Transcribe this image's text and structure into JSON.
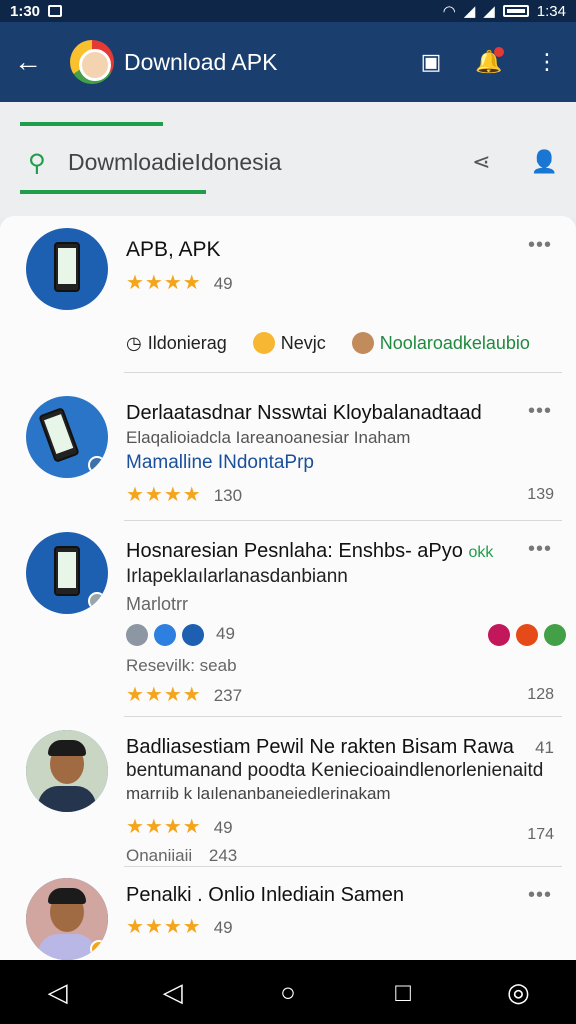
{
  "status_bar": {
    "time": "1:30",
    "clock_right": "1:34"
  },
  "app_bar": {
    "title": "Download APK",
    "back_icon": "arrow-left-icon"
  },
  "search": {
    "value": "DowmloadieIdonesia"
  },
  "items": [
    {
      "name": "APB, APK",
      "rating_count": "49",
      "chips": [
        {
          "label": "Ildonierag",
          "icon": "clock-icon"
        },
        {
          "label": "Nevjc",
          "icon": "emoji-icon"
        },
        {
          "label": "Noolaroadkelaubio",
          "icon": "avatar-icon"
        }
      ]
    },
    {
      "name": "Derlaatasdnar Nsswtai Kloybalanadtaad",
      "line2": "Elaqalioiadcla Iareanoanesiar Inaham",
      "line3": "Mamalline INdontaPrp",
      "rating_count": "130",
      "right_number": "139"
    },
    {
      "name": "Hosnaresian Pesnlaha: Enshbs- aPyo",
      "name_suffix": "okk",
      "line2": "Irlapeklaılarlanasdanbiann",
      "line3": "Marlotrr",
      "rating_count": "49",
      "line4": "Resevilk: seab",
      "rating_count_2": "237",
      "right_number": "128"
    },
    {
      "name": "Badliasestiam Pewil Ne rakten Bisam Rawa",
      "right_top": "41",
      "line2": "bentumanand poodta",
      "line2b": "Keniecioaindlenorlenienaitd",
      "line3": "marrıib k laılenanbaneiedlerinakam",
      "rating_count": "49",
      "line4": "Onaniiaii",
      "line4_count": "243",
      "right_number": "174"
    },
    {
      "name": "Penalki . Onlio Inlediain Samen",
      "rating_count": "49"
    }
  ],
  "colors": {
    "accent_green": "#1f9d4a",
    "app_bar": "#1a3f6e",
    "star": "#f4a51c"
  }
}
